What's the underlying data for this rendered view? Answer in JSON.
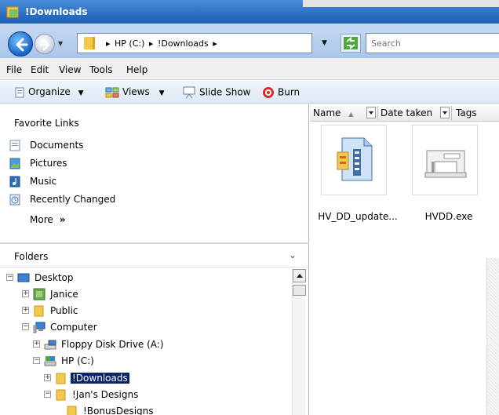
{
  "window": {
    "title": "!Downloads"
  },
  "address": {
    "crumbs": [
      "▸",
      "HP (C:)",
      "▸",
      "!Downloads",
      "▸"
    ],
    "search_placeholder": "Search"
  },
  "menu": {
    "items": [
      "File",
      "Edit",
      "View",
      "Tools",
      "Help"
    ]
  },
  "commands": {
    "organize": "Organize",
    "views": "Views",
    "slideshow": "Slide Show",
    "burn": "Burn",
    "dropdown_glyph": "▼"
  },
  "favorites": {
    "title": "Favorite Links",
    "items": [
      {
        "label": "Documents",
        "icon": "documents-icon"
      },
      {
        "label": "Pictures",
        "icon": "pictures-icon"
      },
      {
        "label": "Music",
        "icon": "music-icon"
      },
      {
        "label": "Recently Changed",
        "icon": "recently-changed-icon"
      }
    ],
    "more_label": "More",
    "more_glyph": "»"
  },
  "folders": {
    "title": "Folders",
    "tree": [
      {
        "label": "Desktop",
        "toggle": "−",
        "icon": "desktop-icon"
      },
      {
        "label": "Janice",
        "toggle": "+",
        "icon": "user-icon"
      },
      {
        "label": "Public",
        "toggle": "+",
        "icon": "folder-icon"
      },
      {
        "label": "Computer",
        "toggle": "−",
        "icon": "computer-icon"
      },
      {
        "label": "Floppy Disk Drive (A:)",
        "toggle": "+",
        "icon": "floppy-icon"
      },
      {
        "label": "HP (C:)",
        "toggle": "−",
        "icon": "drive-icon"
      },
      {
        "label": "!Downloads",
        "toggle": "+",
        "icon": "folder-icon",
        "selected": true
      },
      {
        "label": "!Jan's Designs",
        "toggle": "−",
        "icon": "folder-icon"
      },
      {
        "label": "!BonusDesigns",
        "toggle": "",
        "icon": "folder-icon"
      }
    ]
  },
  "columns": {
    "name": "Name",
    "sort_glyph": "▲",
    "date": "Date taken",
    "tags": "Tags"
  },
  "files": [
    {
      "name": "HV_DD_update...",
      "icon": "zip-installer-icon"
    },
    {
      "name": "HVDD.exe",
      "icon": "sewing-machine-icon"
    }
  ],
  "colors": {
    "titlebar": "#2a6fc3",
    "selection": "#0a246a",
    "folder": "#f3c84b"
  }
}
